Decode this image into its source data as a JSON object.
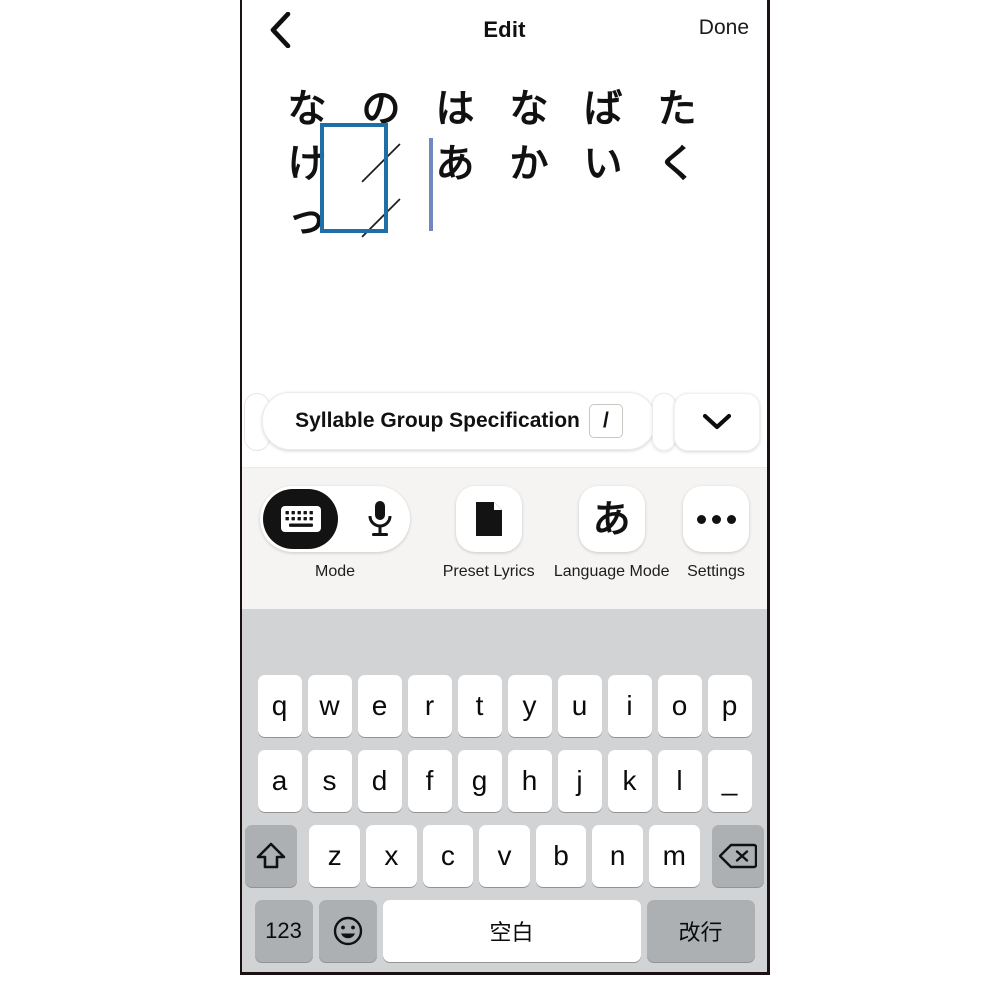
{
  "navbar": {
    "back_icon": "chevron-left-icon",
    "title": "Edit",
    "done_label": "Done"
  },
  "lyric_grid": {
    "columns": 6,
    "rows": [
      [
        "な",
        "の",
        "は",
        "な",
        "ば",
        "た"
      ],
      [
        "け",
        "／",
        "あ",
        "か",
        "い",
        "く"
      ],
      [
        "っ",
        "／",
        "",
        "",
        "",
        ""
      ]
    ],
    "selection": {
      "column_index": 1,
      "row_start": 1,
      "row_end": 2,
      "color": "#1f6ea8"
    },
    "caret": {
      "color": "#7287bd"
    }
  },
  "spec_bar": {
    "label": "Syllable Group Specification",
    "token": "/",
    "chevron_icon": "chevron-down-icon"
  },
  "toolbar": {
    "items": [
      {
        "name": "mode",
        "caption": "Mode",
        "type": "toggle",
        "left_icon": "keyboard-icon",
        "right_icon": "microphone-icon",
        "selected": "keyboard"
      },
      {
        "name": "preset-lyrics",
        "caption": "Preset Lyrics",
        "type": "button",
        "icon": "document-icon"
      },
      {
        "name": "language-mode",
        "caption": "Language Mode",
        "type": "button",
        "icon": "kana-a-icon",
        "glyph": "あ"
      },
      {
        "name": "settings",
        "caption": "Settings",
        "type": "button",
        "icon": "ellipsis-icon"
      }
    ]
  },
  "keyboard": {
    "row1": [
      "q",
      "w",
      "e",
      "r",
      "t",
      "y",
      "u",
      "i",
      "o",
      "p"
    ],
    "row2": [
      "a",
      "s",
      "d",
      "f",
      "g",
      "h",
      "j",
      "k",
      "l",
      "_"
    ],
    "row3": {
      "shift_icon": "shift-up-arrow-icon",
      "letters": [
        "z",
        "x",
        "c",
        "v",
        "b",
        "n",
        "m"
      ],
      "backspace_icon": "backspace-icon"
    },
    "row4": {
      "numeric_label": "123",
      "emoji_icon": "smiley-face-icon",
      "space_label": "空白",
      "return_label": "改行"
    }
  },
  "colors": {
    "selection_blue": "#1f6ea8",
    "caret_blue": "#7287bd",
    "keyboard_bg": "#d1d3d4",
    "key_bg": "#ffffff",
    "key_dark_bg": "#adb0b3",
    "toolstrip_bg": "#f5f4f2",
    "knob_black": "#131313"
  }
}
